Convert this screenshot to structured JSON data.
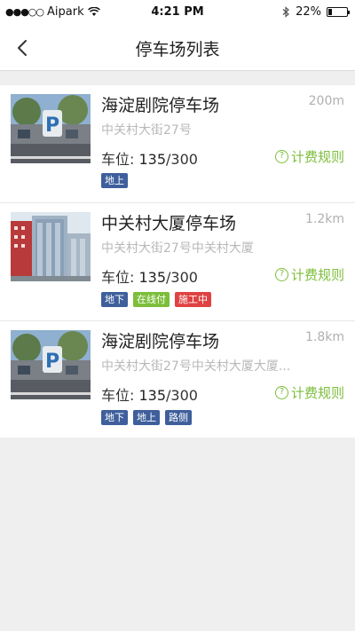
{
  "status_bar": {
    "signal": "●●●○○",
    "carrier": "Aipark",
    "time": "4:21 PM",
    "battery": "22%",
    "battery_level": 0.22
  },
  "header": {
    "title": "停车场列表",
    "back_icon": "chevron-left-icon"
  },
  "colors": {
    "accent_green": "#7cbe3a",
    "tag_blue": "#3f5f9c",
    "tag_green": "#7cbe3a",
    "tag_red": "#e04242"
  },
  "labels": {
    "spots_prefix": "车位: ",
    "fee_rule": "计费规则"
  },
  "parking_lots": [
    {
      "name": "海淀剧院停车场",
      "distance": "200m",
      "address": "中关村大街27号",
      "available": "135",
      "total": "/300",
      "tags": [
        {
          "label": "地上",
          "color": "#3f5f9c"
        }
      ]
    },
    {
      "name": "中关村大厦停车场",
      "distance": "1.2km",
      "address": "中关村大街27号中关村大厦",
      "available": "135",
      "total": "/300",
      "tags": [
        {
          "label": "地下",
          "color": "#3f5f9c"
        },
        {
          "label": "在线付",
          "color": "#7cbe3a"
        },
        {
          "label": "施工中",
          "color": "#e04242"
        }
      ]
    },
    {
      "name": "海淀剧院停车场",
      "distance": "1.8km",
      "address": "中关村大街27号中关村大厦大厦...",
      "available": "135",
      "total": "/300",
      "tags": [
        {
          "label": "地下",
          "color": "#3f5f9c"
        },
        {
          "label": "地上",
          "color": "#3f5f9c"
        },
        {
          "label": "路侧",
          "color": "#3f5f9c"
        }
      ]
    }
  ]
}
